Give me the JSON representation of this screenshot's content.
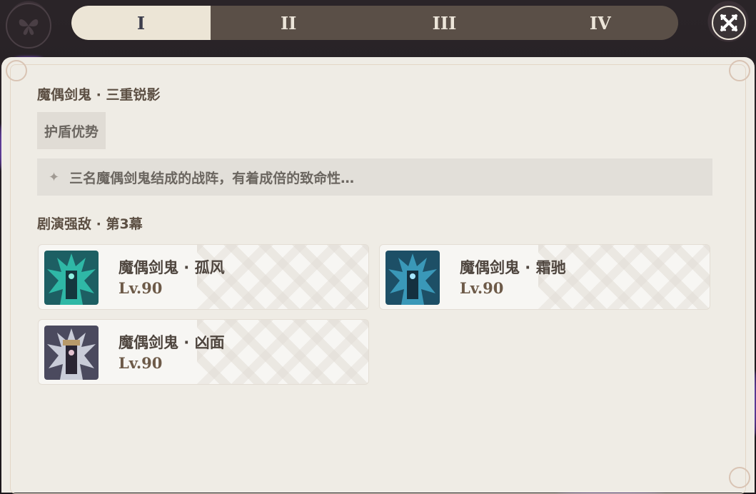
{
  "tabs": [
    {
      "label": "I",
      "active": true
    },
    {
      "label": "II",
      "active": false
    },
    {
      "label": "III",
      "active": false
    },
    {
      "label": "IV",
      "active": false
    }
  ],
  "encounter": {
    "title": "魔偶剑鬼 · 三重锐影",
    "tag": "护盾优势",
    "description": "三名魔偶剑鬼结成的战阵，有着成倍的致命性…"
  },
  "section": {
    "title": "剧演强敌 · 第3幕"
  },
  "enemies": [
    {
      "name": "魔偶剑鬼 · 孤风",
      "level": "Lv.90",
      "portrait_color": "#2fb8a6"
    },
    {
      "name": "魔偶剑鬼 · 霜驰",
      "level": "Lv.90",
      "portrait_color": "#3a98b8"
    },
    {
      "name": "魔偶剑鬼 · 凶面",
      "level": "Lv.90",
      "portrait_color": "#8a8fb0"
    }
  ],
  "icons": {
    "close": "close-icon",
    "emblem": "butterfly-icon",
    "bullet": "sparkle-icon"
  },
  "colors": {
    "panel_bg": "#efece5",
    "tab_active_bg": "#ece5d6",
    "tab_bg": "#5a4f47",
    "accent_glow": "#7a4bd0"
  }
}
